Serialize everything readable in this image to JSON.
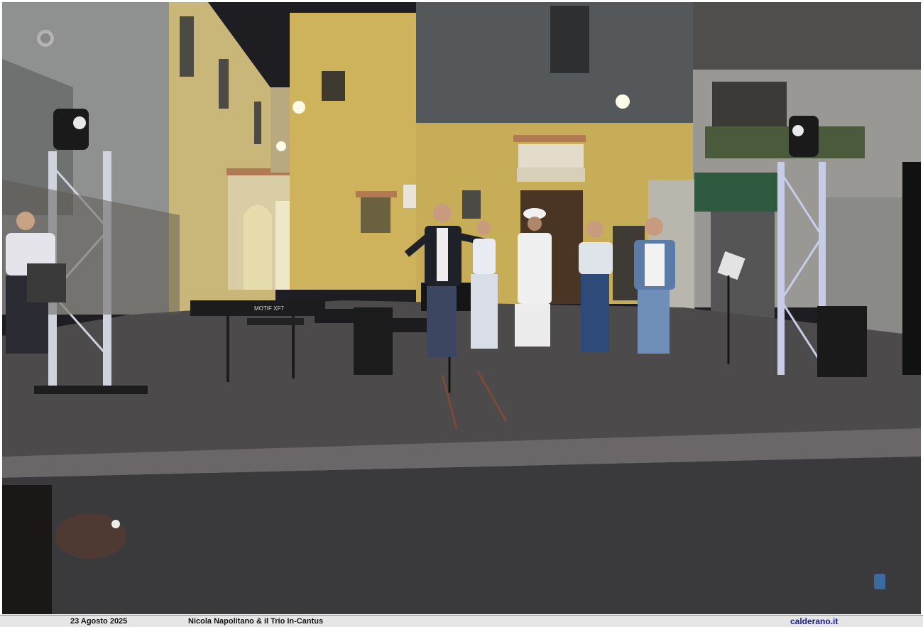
{
  "caption": {
    "date": "23 Agosto 2025",
    "event": "Nicola Napolitano & il Trio In-Cantus",
    "site": "calderano.it"
  },
  "scene": {
    "keyboard_brand": "MOTIF XF7",
    "colors": {
      "wall_yellow": "#cdb25a",
      "wall_grey": "#55585a",
      "pavement": "#4d4a4c",
      "road": "#3a3a3c",
      "truss": "#cfd3dd",
      "sky_dark": "#1e1d22"
    }
  }
}
